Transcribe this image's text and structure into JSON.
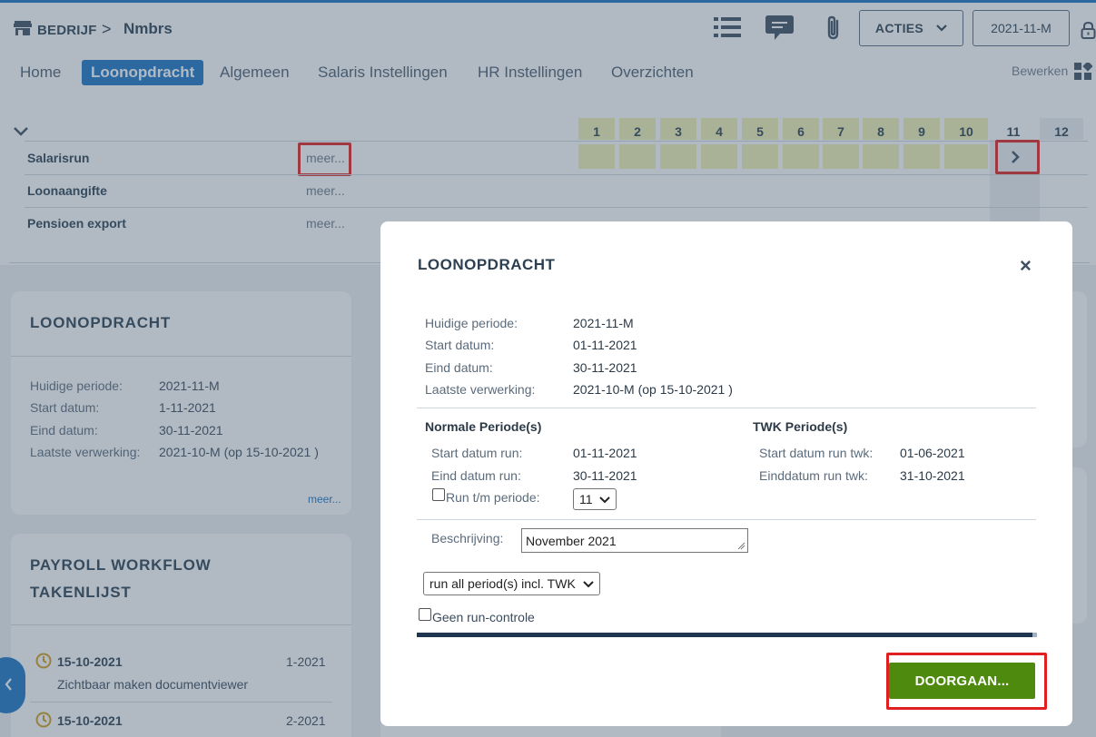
{
  "header": {
    "company_label": "BEDRIJF",
    "separator": ">",
    "company_name": "Nmbrs",
    "acties_label": "ACTIES",
    "period_label": "2021-11-M"
  },
  "tabs": [
    {
      "label": "Home"
    },
    {
      "label": "Loonopdracht"
    },
    {
      "label": "Algemeen"
    },
    {
      "label": "Salaris Instellingen"
    },
    {
      "label": "HR Instellingen"
    },
    {
      "label": "Overzichten"
    }
  ],
  "bewerken_label": "Bewerken",
  "run_grid": {
    "columns": [
      "1",
      "2",
      "3",
      "4",
      "5",
      "6",
      "7",
      "8",
      "9",
      "10",
      "11",
      "12"
    ],
    "rows": [
      {
        "label": "Salarisrun",
        "more": "meer..."
      },
      {
        "label": "Loonaangifte",
        "more": "meer..."
      },
      {
        "label": "Pensioen export",
        "more": "meer..."
      }
    ]
  },
  "card_loonopdracht": {
    "title": "LOONOPDRACHT",
    "items": [
      {
        "label": "Huidige periode:",
        "value": "2021-11-M"
      },
      {
        "label": "Start datum:",
        "value": "1-11-2021"
      },
      {
        "label": "Eind datum:",
        "value": "30-11-2021"
      },
      {
        "label": "Laatste verwerking:",
        "value": "2021-10-M (op 15-10-2021 )"
      }
    ],
    "more": "meer..."
  },
  "card_workflow": {
    "title_line1": "PAYROLL WORKFLOW",
    "title_line2": "TAKENLIJST",
    "tasks": [
      {
        "date": "15-10-2021",
        "period": "1-2021",
        "desc": "Zichtbaar maken documentviewer"
      },
      {
        "date": "15-10-2021",
        "period": "2-2021",
        "desc": ""
      }
    ]
  },
  "modal": {
    "title": "LOONOPDRACHT",
    "close": "×",
    "info": [
      {
        "label": "Huidige periode:",
        "value": "2021-11-M"
      },
      {
        "label": "Start datum:",
        "value": "01-11-2021"
      },
      {
        "label": "Eind datum:",
        "value": "30-11-2021"
      },
      {
        "label": "Laatste verwerking:",
        "value": "2021-10-M (op 15-10-2021 )"
      }
    ],
    "normal_heading": "Normale Periode(s)",
    "normal": [
      {
        "label": "Start datum run:",
        "value": "01-11-2021"
      },
      {
        "label": "Eind datum run:",
        "value": "30-11-2021"
      }
    ],
    "run_tm_label": "Run t/m periode:",
    "run_tm_value": "11",
    "twk_heading": "TWK Periode(s)",
    "twk": [
      {
        "label": "Start datum run twk:",
        "value": "01-06-2021"
      },
      {
        "label": "Einddatum run twk:",
        "value": "31-10-2021"
      }
    ],
    "beschrijving_label": "Beschrijving:",
    "beschrijving_value": "November 2021",
    "run_option": "run all period(s) incl. TWK",
    "geen_label": "Geen run-controle",
    "progress": 0.99,
    "doorgaan_label": "DOORGAAN..."
  },
  "colors": {
    "accent": "#1b74c5",
    "period_highlight": "#f2f2b4",
    "primary_button": "#4e8a0e",
    "highlight_box": "#e02020"
  }
}
